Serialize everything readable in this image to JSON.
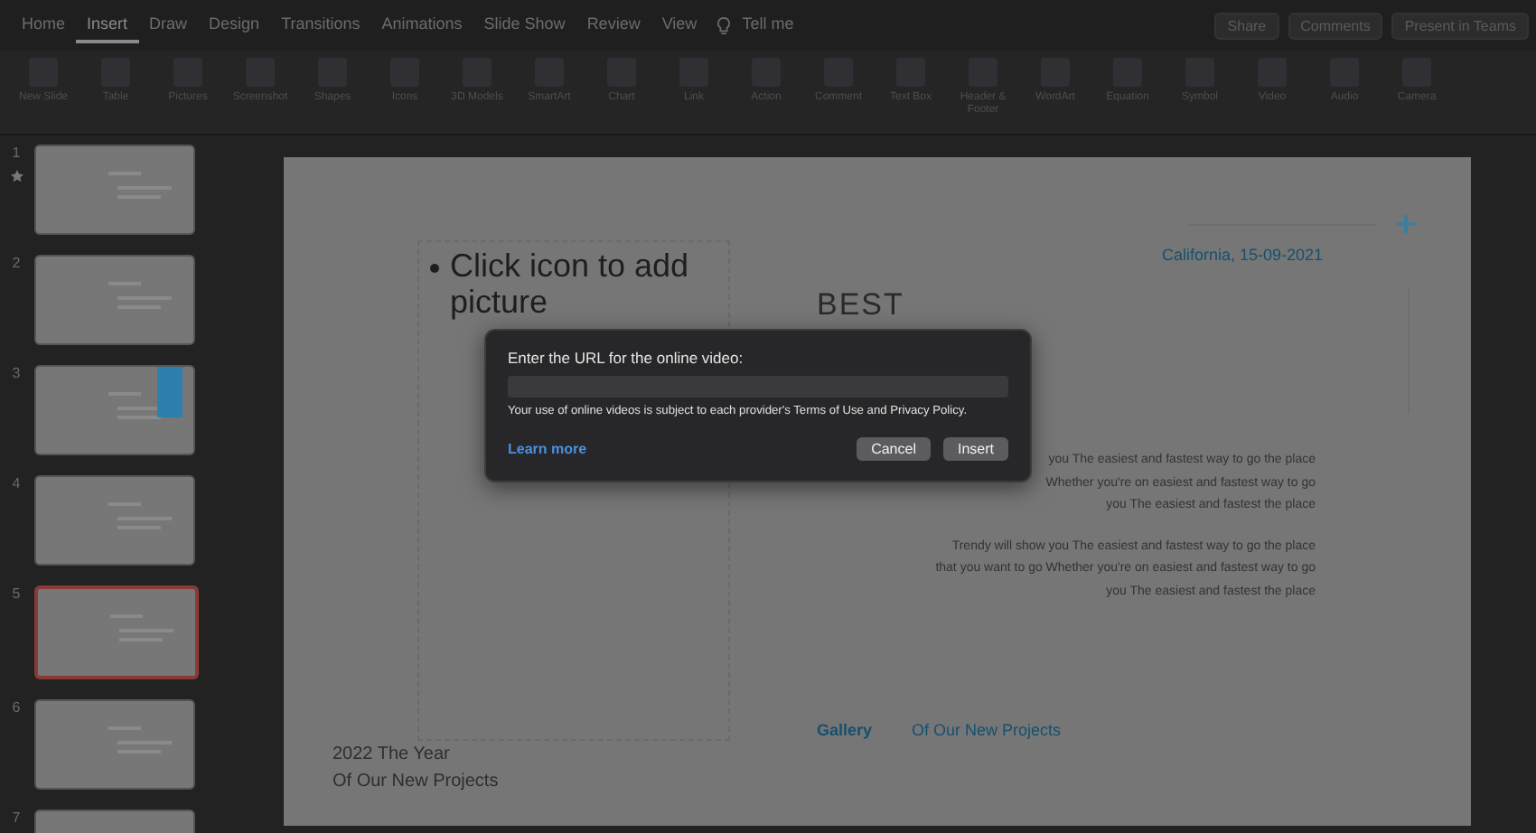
{
  "menu_tabs": [
    {
      "label": "Home",
      "selected": false
    },
    {
      "label": "Insert",
      "selected": true
    },
    {
      "label": "Draw",
      "selected": false
    },
    {
      "label": "Design",
      "selected": false
    },
    {
      "label": "Transitions",
      "selected": false
    },
    {
      "label": "Animations",
      "selected": false
    },
    {
      "label": "Slide Show",
      "selected": false
    },
    {
      "label": "Review",
      "selected": false
    },
    {
      "label": "View",
      "selected": false
    }
  ],
  "tell_me": "Tell me",
  "top_buttons": [
    "Share",
    "Comments",
    "Present in Teams"
  ],
  "ribbon": [
    {
      "label": "New Slide"
    },
    {
      "label": "Table"
    },
    {
      "label": "Pictures"
    },
    {
      "label": "Screenshot"
    },
    {
      "label": "Shapes"
    },
    {
      "label": "Icons"
    },
    {
      "label": "3D Models"
    },
    {
      "label": "SmartArt"
    },
    {
      "label": "Chart"
    },
    {
      "label": "Link"
    },
    {
      "label": "Action"
    },
    {
      "label": "Comment"
    },
    {
      "label": "Text Box"
    },
    {
      "label": "Header & Footer"
    },
    {
      "label": "WordArt"
    },
    {
      "label": "Equation"
    },
    {
      "label": "Symbol"
    },
    {
      "label": "Video"
    },
    {
      "label": "Audio"
    },
    {
      "label": "Camera"
    }
  ],
  "slides": [
    {
      "number": "1",
      "starred": true,
      "selected": false,
      "accent": false
    },
    {
      "number": "2",
      "starred": false,
      "selected": false,
      "accent": false
    },
    {
      "number": "3",
      "starred": false,
      "selected": false,
      "accent": true
    },
    {
      "number": "4",
      "starred": false,
      "selected": false,
      "accent": false
    },
    {
      "number": "5",
      "starred": false,
      "selected": true,
      "accent": false
    },
    {
      "number": "6",
      "starred": false,
      "selected": false,
      "accent": false
    },
    {
      "number": "7",
      "starred": false,
      "selected": false,
      "accent": false
    }
  ],
  "slide": {
    "placeholder": "Click icon to add picture",
    "title": "BEST",
    "date": "California, 15-09-2021",
    "paragraphs": [
      [
        "you The easiest and fastest way to go the place",
        "Whether you're on easiest and fastest way to go",
        "you The easiest and fastest the place"
      ],
      [
        "Trendy will show you The easiest and fastest way to go the place",
        "that you want to go Whether you're on easiest and fastest way to go",
        "you The easiest and fastest the place"
      ]
    ],
    "gallery": "Gallery",
    "gallery_sub": "Of Our New Projects",
    "year": "2022 The Year",
    "year_sub": "Of Our New Projects"
  },
  "dialog": {
    "prompt": "Enter the URL for the online video:",
    "notice": "Your use of online videos is subject to each provider's Terms of Use and Privacy Policy.",
    "link": "Learn more",
    "buttons": [
      "Cancel",
      "Insert"
    ]
  }
}
